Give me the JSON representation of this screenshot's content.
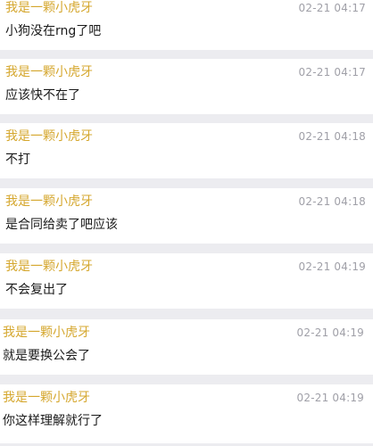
{
  "comments": [
    {
      "user": "我是一颗小虎牙",
      "time": "02-21 04:17",
      "text": "小狗没在rng了吧"
    },
    {
      "user": "我是一颗小虎牙",
      "time": "02-21 04:17",
      "text": "应该快不在了"
    },
    {
      "user": "我是一颗小虎牙",
      "time": "02-21 04:18",
      "text": "不打"
    },
    {
      "user": "我是一颗小虎牙",
      "time": "02-21 04:18",
      "text": "是合同给卖了吧应该"
    },
    {
      "user": "我是一颗小虎牙",
      "time": "02-21 04:19",
      "text": "不会复出了"
    },
    {
      "user": "我是一颗小虎牙",
      "time": "02-21 04:19",
      "text": "就是要换公会了"
    },
    {
      "user": "我是一颗小虎牙",
      "time": "02-21 04:19",
      "text": "你这样理解就行了"
    }
  ],
  "colors": {
    "username": "#d5a72e",
    "timestamp": "#a0a0a8",
    "message": "#1a1a1a",
    "background": "#ececf0"
  }
}
